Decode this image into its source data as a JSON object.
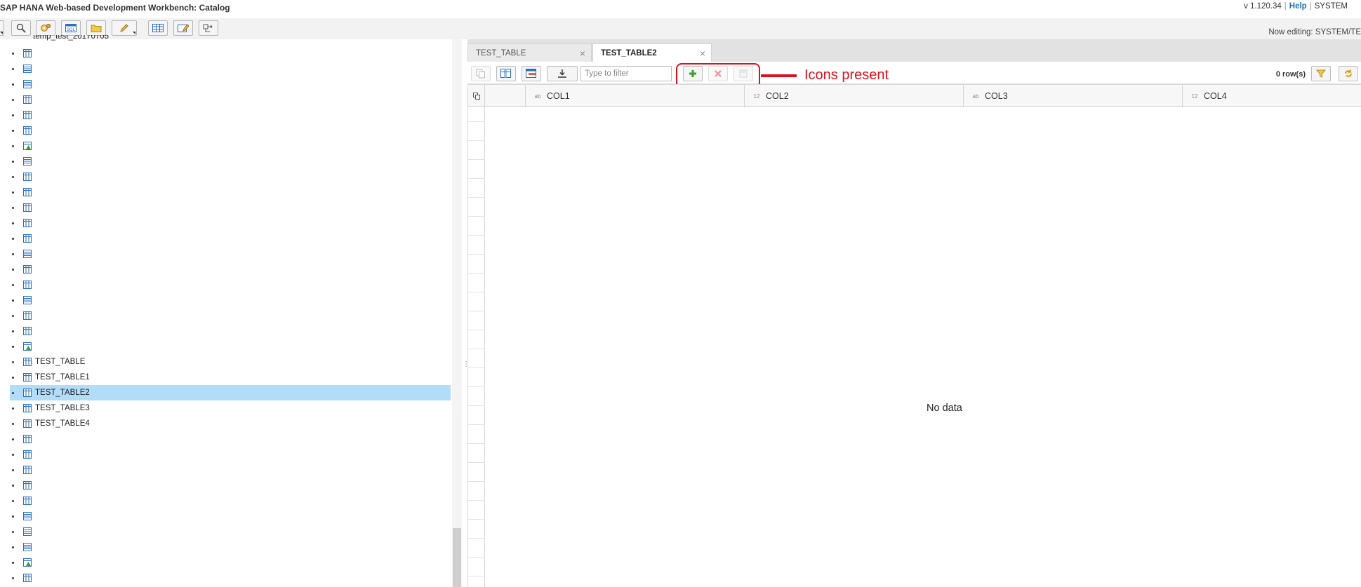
{
  "app": {
    "title": "SAP HANA Web-based Development Workbench: Catalog",
    "version": "v 1.120.34",
    "help_label": "Help",
    "user": "SYSTEM",
    "editing_status": "Now editing: SYSTEM/TE"
  },
  "toolbar": {
    "buttons": [
      {
        "icon": "menu-caret-icon"
      },
      {
        "icon": "search-icon"
      },
      {
        "icon": "settings-icon"
      },
      {
        "icon": "sql-console-icon"
      },
      {
        "icon": "open-folder-icon"
      },
      {
        "icon": "edit-pencil-icon"
      },
      {
        "icon": "table-grid-icon"
      },
      {
        "icon": "edit-table-icon"
      },
      {
        "icon": "navigate-icon"
      }
    ]
  },
  "tree": {
    "partial_label": "temp_test_20170705",
    "items": [
      {
        "icon": "table",
        "label": ""
      },
      {
        "icon": "view",
        "label": ""
      },
      {
        "icon": "view",
        "label": ""
      },
      {
        "icon": "table",
        "label": ""
      },
      {
        "icon": "table",
        "label": ""
      },
      {
        "icon": "table",
        "label": ""
      },
      {
        "icon": "table-green",
        "label": ""
      },
      {
        "icon": "view",
        "label": ""
      },
      {
        "icon": "table",
        "label": ""
      },
      {
        "icon": "table",
        "label": ""
      },
      {
        "icon": "table",
        "label": ""
      },
      {
        "icon": "table",
        "label": ""
      },
      {
        "icon": "table",
        "label": ""
      },
      {
        "icon": "view",
        "label": ""
      },
      {
        "icon": "table",
        "label": ""
      },
      {
        "icon": "table",
        "label": ""
      },
      {
        "icon": "view",
        "label": ""
      },
      {
        "icon": "table",
        "label": ""
      },
      {
        "icon": "table",
        "label": ""
      },
      {
        "icon": "table-green",
        "label": ""
      },
      {
        "icon": "table",
        "label": "TEST_TABLE"
      },
      {
        "icon": "table",
        "label": "TEST_TABLE1"
      },
      {
        "icon": "table",
        "label": "TEST_TABLE2",
        "selected": true
      },
      {
        "icon": "table",
        "label": "TEST_TABLE3"
      },
      {
        "icon": "table",
        "label": "TEST_TABLE4"
      },
      {
        "icon": "table",
        "label": ""
      },
      {
        "icon": "table",
        "label": ""
      },
      {
        "icon": "table",
        "label": ""
      },
      {
        "icon": "table",
        "label": ""
      },
      {
        "icon": "table",
        "label": ""
      },
      {
        "icon": "view",
        "label": ""
      },
      {
        "icon": "view",
        "label": ""
      },
      {
        "icon": "view",
        "label": ""
      },
      {
        "icon": "table-green",
        "label": ""
      },
      {
        "icon": "table",
        "label": ""
      }
    ]
  },
  "editor": {
    "tabs": [
      {
        "label": "TEST_TABLE",
        "active": false
      },
      {
        "label": "TEST_TABLE2",
        "active": true
      }
    ],
    "filter_placeholder": "Type to filter",
    "row_count": "0 row(s)",
    "columns": [
      {
        "type_icon": "ab",
        "name": "COL1"
      },
      {
        "type_icon": "12",
        "name": "COL2"
      },
      {
        "type_icon": "ab",
        "name": "COL3"
      },
      {
        "type_icon": "12",
        "name": "COL4"
      }
    ],
    "empty_message": "No data"
  },
  "annotation": {
    "text": "Icons present",
    "color": "#e0101b"
  }
}
